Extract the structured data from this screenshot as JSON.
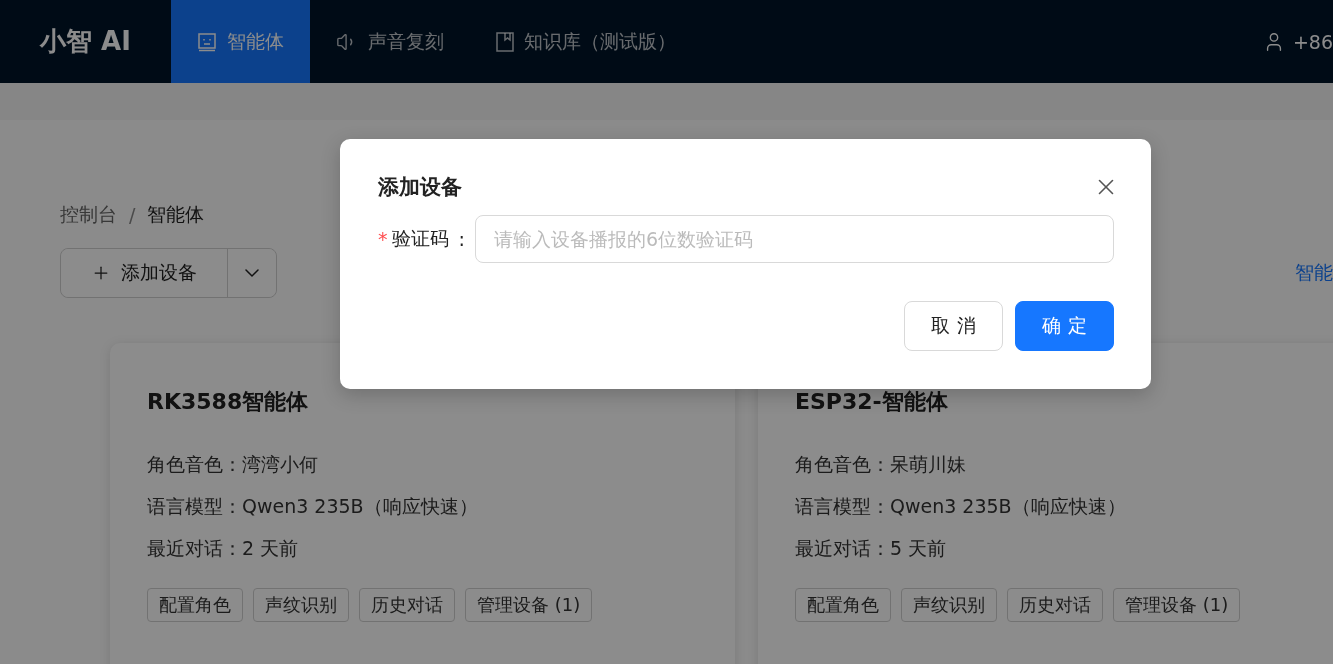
{
  "header": {
    "logo": "小智 AI",
    "nav": [
      {
        "label": "智能体",
        "selected": true
      },
      {
        "label": "声音复刻",
        "selected": false
      },
      {
        "label": "知识库（测试版）",
        "selected": false
      }
    ],
    "user": "+86"
  },
  "breadcrumb": [
    "控制台",
    "智能体"
  ],
  "breadcrumb_separator": "/",
  "add_button": {
    "label": "添加设备"
  },
  "right_link": "智能",
  "cards": [
    {
      "title": "RK3588智能体",
      "fields": [
        "角色音色：湾湾小何",
        "语言模型：Qwen3 235B（响应快速）",
        "最近对话：2 天前"
      ],
      "actions": [
        "配置角色",
        "声纹识别",
        "历史对话",
        "管理设备 (1)"
      ]
    },
    {
      "title": "ESP32-智能体",
      "fields": [
        "角色音色：呆萌川妹",
        "语言模型：Qwen3 235B（响应快速）",
        "最近对话：5 天前"
      ],
      "actions": [
        "配置角色",
        "声纹识别",
        "历史对话",
        "管理设备 (1)"
      ]
    }
  ],
  "dialog": {
    "title": "添加设备",
    "field": {
      "required_mark": "*",
      "label": "验证码",
      "suffix": ":",
      "placeholder": "请输入设备播报的6位数验证码"
    },
    "buttons": [
      {
        "label": "取 消",
        "kind": "default"
      },
      {
        "label": "确 定",
        "kind": "primary"
      }
    ]
  }
}
